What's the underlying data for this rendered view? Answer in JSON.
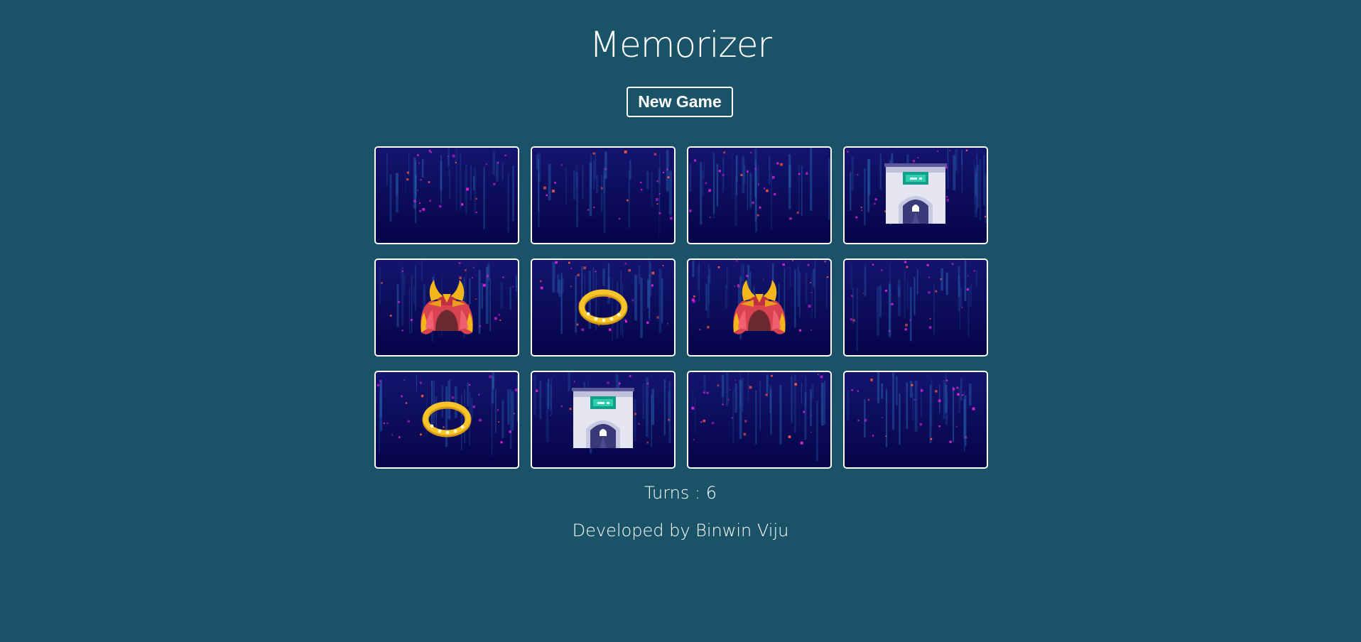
{
  "app": {
    "title": "Memorizer",
    "new_game_label": "New Game"
  },
  "board": {
    "columns": 4,
    "rows": 3,
    "cards": [
      {
        "state": "hidden",
        "icon": null
      },
      {
        "state": "hidden",
        "icon": null
      },
      {
        "state": "hidden",
        "icon": null
      },
      {
        "state": "revealed",
        "icon": "castle-gate-icon"
      },
      {
        "state": "revealed",
        "icon": "samurai-helmet-icon"
      },
      {
        "state": "revealed",
        "icon": "gold-ring-icon"
      },
      {
        "state": "revealed",
        "icon": "samurai-helmet-icon"
      },
      {
        "state": "hidden",
        "icon": null
      },
      {
        "state": "revealed",
        "icon": "gold-ring-icon"
      },
      {
        "state": "revealed",
        "icon": "castle-gate-icon"
      },
      {
        "state": "hidden",
        "icon": null
      },
      {
        "state": "hidden",
        "icon": null
      }
    ]
  },
  "status": {
    "turns_text": "Turns : 6"
  },
  "footer": {
    "credit_text": "Developed by Binwin Viju"
  },
  "colors": {
    "background": "#1a5368",
    "card_back": "#0a0a55",
    "accent_magenta": "#e020e0",
    "card_border": "#ffffff"
  }
}
